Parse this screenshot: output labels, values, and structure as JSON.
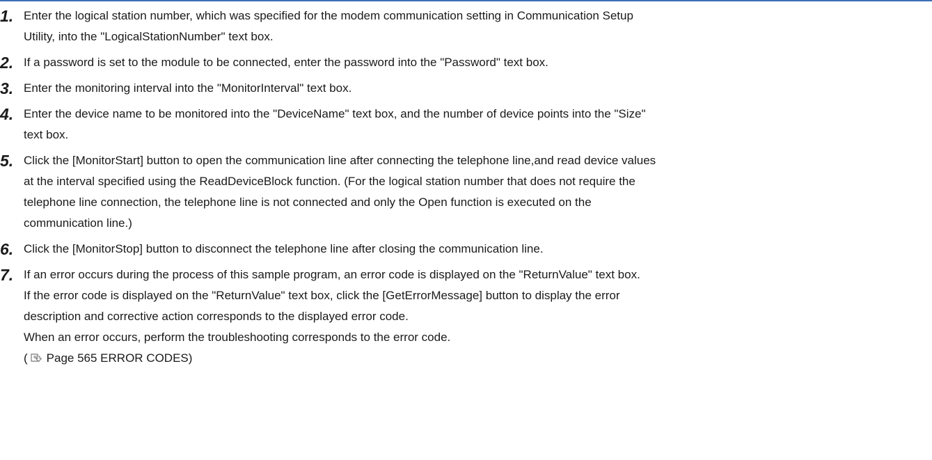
{
  "steps": [
    {
      "number": "1.",
      "lines": [
        "Enter the logical station number, which was specified for the modem communication setting in Communication Setup",
        "Utility, into the \"LogicalStationNumber\" text box."
      ]
    },
    {
      "number": "2.",
      "lines": [
        "If a password is set to the module to be connected, enter the password into the \"Password\" text box."
      ]
    },
    {
      "number": "3.",
      "lines": [
        "Enter the monitoring interval into the \"MonitorInterval\" text box."
      ]
    },
    {
      "number": "4.",
      "lines": [
        "Enter the device name to be monitored into the \"DeviceName\" text box, and the number of device points into the \"Size\"",
        "text box."
      ]
    },
    {
      "number": "5.",
      "lines": [
        "Click the [MonitorStart] button to open the communication line after connecting the telephone line,and read device values",
        "at the interval specified using the ReadDeviceBlock function. (For the logical station number that does not require the",
        "telephone line connection, the telephone line is not connected and only the Open function is executed on the",
        "communication line.)"
      ]
    },
    {
      "number": "6.",
      "lines": [
        "Click the [MonitorStop] button to disconnect the telephone line after closing the communication line."
      ]
    },
    {
      "number": "7.",
      "lines": [
        "If an error occurs during the process of this sample program, an error code is displayed on the \"ReturnValue\" text box.",
        "If the error code is displayed on the \"ReturnValue\" text box, click the [GetErrorMessage] button to display the error",
        "description and corrective action corresponds to the displayed error code.",
        "When an error occurs, perform the troubleshooting corresponds to the error code."
      ],
      "reference": {
        "open": "(",
        "icon": "page-reference-icon",
        "text": "Page 565 ERROR CODES",
        "close": ")"
      }
    }
  ]
}
